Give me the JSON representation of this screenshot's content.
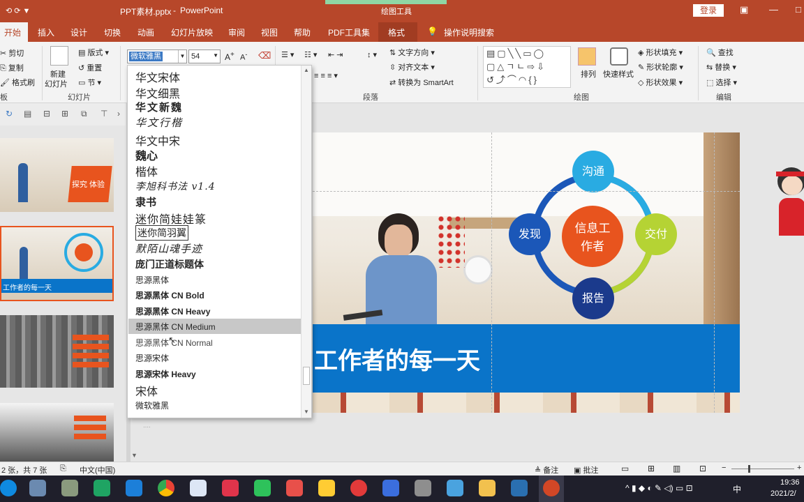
{
  "titlebar": {
    "filename": "PPT素材.pptx",
    "separator": "-",
    "app": "PowerPoint",
    "context_tab": "绘图工具",
    "login": "登录"
  },
  "tabs": [
    "开始",
    "插入",
    "设计",
    "切换",
    "动画",
    "幻灯片放映",
    "审阅",
    "视图",
    "帮助",
    "PDF工具集",
    "格式"
  ],
  "tell_me": "操作说明搜索",
  "ribbon": {
    "clipboard": {
      "cut": "剪切",
      "copy": "复制",
      "format_painter": "格式刷",
      "label": "板"
    },
    "slides": {
      "new_slide": "新建",
      "new_slide2": "幻灯片",
      "layout": "版式",
      "reset": "重置",
      "section": "节",
      "label": "幻灯片"
    },
    "font": {
      "name": "微软雅黑",
      "size": "54"
    },
    "paragraph": {
      "text_direction": "文字方向",
      "align_text": "对齐文本",
      "smartart": "转换为 SmartArt",
      "label": "段落"
    },
    "drawing": {
      "arrange": "排列",
      "quick_styles": "快速样式",
      "fill": "形状填充",
      "outline": "形状轮廓",
      "effects": "形状效果",
      "label": "绘图"
    },
    "editing": {
      "find": "查找",
      "replace": "替换",
      "select": "选择",
      "label": "编辑"
    }
  },
  "font_list": [
    "华文宋体",
    "华文细黑",
    "华文新魏",
    "华文行楷",
    "华文中宋",
    "魏心",
    "楷体",
    "李旭科书法 v1.4",
    "隶书",
    "迷你简娃娃篆",
    "迷你简羽翼",
    "默陌山魂手迹",
    "庞门正道标题体",
    "思源黑体",
    "思源黑体 CN Bold",
    "思源黑体 CN Heavy",
    "思源黑体 CN Medium",
    "思源黑体 CN Normal",
    "思源宋体",
    "思源宋体 Heavy",
    "宋体",
    "微软雅黑"
  ],
  "font_list_highlighted": "思源黑体 CN Medium",
  "thumbnails": {
    "t1": "探究 体验",
    "t2": "工作者的每一天"
  },
  "slide": {
    "banner": "工作者的每一天",
    "center_line1": "信息工",
    "center_line2": "作者",
    "top": "沟通",
    "left": "发现",
    "right": "交付",
    "bottom": "报告"
  },
  "status": {
    "slide_info": "2 张，共 7 张",
    "language": "中文(中国)",
    "notes": "备注",
    "comments": "批注"
  },
  "taskbar": {
    "time": "19:36",
    "date": "2021/2/",
    "ime": "中"
  },
  "colors": {
    "ppt_red": "#b7472a",
    "blue": "#0a74c9",
    "orange": "#e8541e",
    "green": "#b5d334",
    "cyan": "#29abe2",
    "navy": "#1b3a8c"
  }
}
